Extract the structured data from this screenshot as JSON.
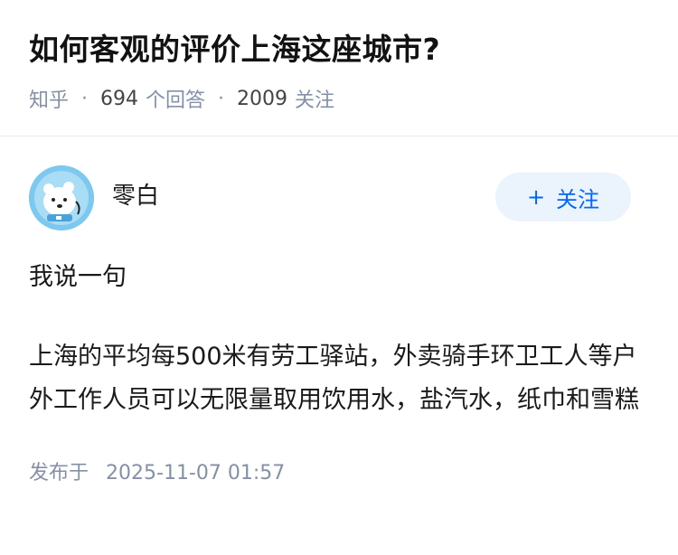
{
  "question": {
    "title": "如何客观的评价上海这座城市?",
    "source": "知乎",
    "answers_count": "694",
    "answers_label": "个回答",
    "followers_count": "2009",
    "followers_label": "关注",
    "separator": "·"
  },
  "answer": {
    "author_name": "零白",
    "avatar_icon": "polar-bear-avatar",
    "follow_button": {
      "plus": "+",
      "label": "关注"
    },
    "paragraphs": [
      "我说一句",
      "上海的平均每500米有劳工驿站，外卖骑手环卫工人等户外工作人员可以无限量取用饮用水，盐汽水，纸巾和雪糕"
    ],
    "published_label": "发布于",
    "published_time": "2025-11-07 01:57"
  },
  "colors": {
    "accent": "#0066ff",
    "follow_bg": "#ebf3fc",
    "meta_text": "#8590a6",
    "avatar_bg": "#7cc8f0"
  }
}
